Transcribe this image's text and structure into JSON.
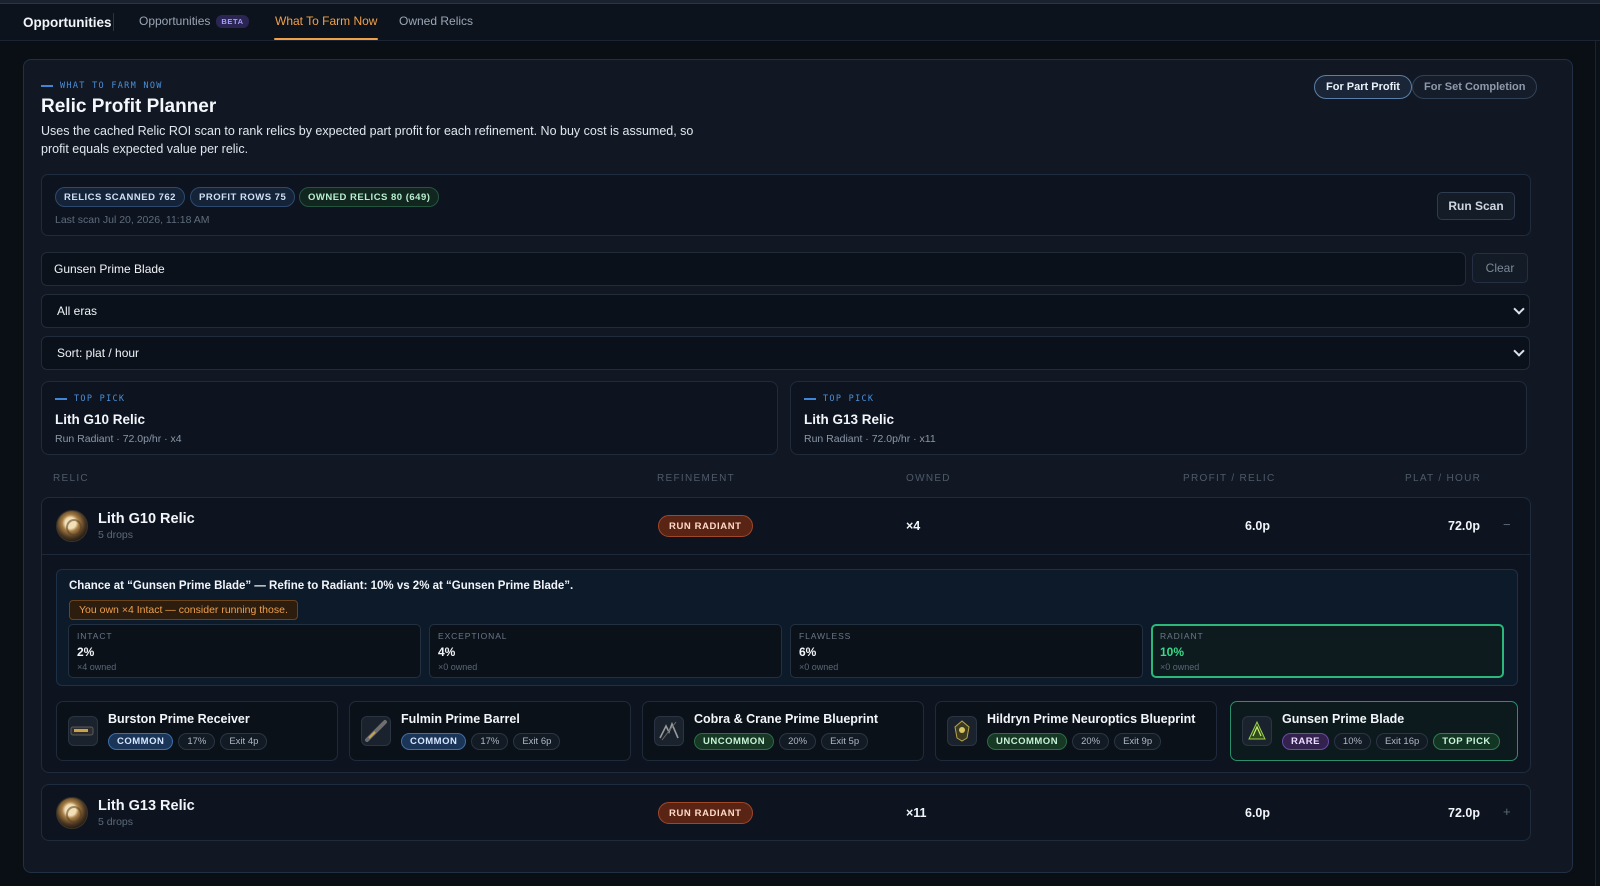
{
  "nav": {
    "brand": "Opportunities",
    "tabs": [
      {
        "label": "Opportunities",
        "badge": "BETA"
      },
      {
        "label": "What To Farm Now"
      },
      {
        "label": "Owned Relics"
      }
    ],
    "active_tab": "What To Farm Now"
  },
  "header": {
    "eyebrow": "What To Farm Now",
    "title": "Relic Profit Planner",
    "description": "Uses the cached Relic ROI scan to rank relics by expected part profit for each refinement. No buy cost is assumed, so profit equals expected value per relic.",
    "mode_buttons": [
      "For Part Profit",
      "For Set Completion"
    ],
    "active_mode": "For Part Profit"
  },
  "stats": {
    "badges": [
      "RELICS SCANNED 762",
      "PROFIT ROWS 75",
      "OWNED RELICS 80 (649)"
    ],
    "last_scan": "Last scan Jul 20, 2026, 11:18 AM",
    "run_scan_label": "Run Scan"
  },
  "filters": {
    "search_value": "Gunsen Prime Blade",
    "clear_label": "Clear",
    "era_selected": "All eras",
    "sort_selected": "Sort: plat / hour"
  },
  "top_picks": [
    {
      "eyebrow": "Top Pick",
      "name": "Lith G10 Relic",
      "sub": "Run Radiant · 72.0p/hr · x4"
    },
    {
      "eyebrow": "Top Pick",
      "name": "Lith G13 Relic",
      "sub": "Run Radiant · 72.0p/hr · x11"
    }
  ],
  "table": {
    "columns": [
      "RELIC",
      "REFINEMENT",
      "OWNED",
      "PROFIT / RELIC",
      "PLAT / HOUR"
    ],
    "rows": [
      {
        "name": "Lith G10 Relic",
        "drops": "5 drops",
        "refinement": "RUN RADIANT",
        "owned": "×4",
        "profit": "6.0p",
        "plat_hour": "72.0p",
        "toggle": "−",
        "expanded": {
          "chance_text": "Chance at “Gunsen Prime Blade” — Refine to Radiant: 10% vs 2% at “Gunsen Prime Blade”.",
          "hint": "You own ×4 Intact — consider running those.",
          "tiers": [
            {
              "label": "INTACT",
              "value": "2%",
              "owned": "×4 owned"
            },
            {
              "label": "EXCEPTIONAL",
              "value": "4%",
              "owned": "×0 owned"
            },
            {
              "label": "FLAWLESS",
              "value": "6%",
              "owned": "×0 owned"
            },
            {
              "label": "RADIANT",
              "value": "10%",
              "owned": "×0 owned"
            }
          ],
          "best_tier": "RADIANT",
          "parts": [
            {
              "name": "Burston Prime Receiver",
              "rarity": "COMMON",
              "chance": "17%",
              "exit": "Exit 4p",
              "icon": "receiver-icon"
            },
            {
              "name": "Fulmin Prime Barrel",
              "rarity": "COMMON",
              "chance": "17%",
              "exit": "Exit 6p",
              "icon": "barrel-icon"
            },
            {
              "name": "Cobra & Crane Prime Blueprint",
              "rarity": "UNCOMMON",
              "chance": "20%",
              "exit": "Exit 5p",
              "icon": "blueprint-icon"
            },
            {
              "name": "Hildryn Prime Neuroptics Blueprint",
              "rarity": "UNCOMMON",
              "chance": "20%",
              "exit": "Exit 9p",
              "icon": "neuroptics-icon"
            },
            {
              "name": "Gunsen Prime Blade",
              "rarity": "RARE",
              "chance": "10%",
              "exit": "Exit 16p",
              "icon": "blade-icon",
              "tag": "TOP PICK"
            }
          ]
        }
      },
      {
        "name": "Lith G13 Relic",
        "drops": "5 drops",
        "refinement": "RUN RADIANT",
        "owned": "×11",
        "profit": "6.0p",
        "plat_hour": "72.0p",
        "toggle": "+"
      }
    ]
  },
  "colors": {
    "accent_orange": "#f0a04a",
    "accent_blue": "#4a8fd8",
    "radiant_green": "#39d98a",
    "refine_badge": "#5a2414"
  }
}
